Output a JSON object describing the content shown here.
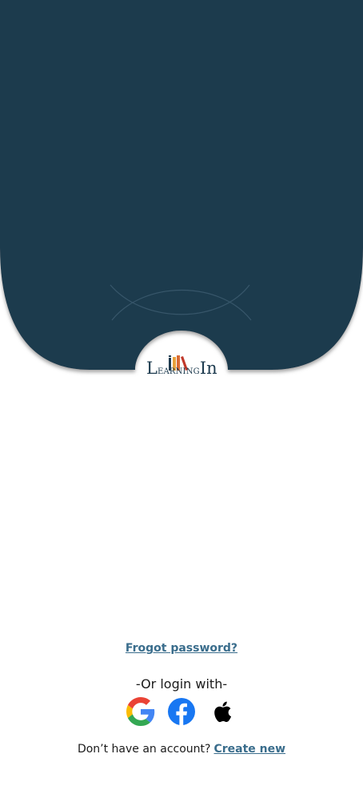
{
  "header": {
    "brand": {
      "part1_big": "L",
      "part1_small": "EARNING",
      "part2_big": "In"
    },
    "colors": {
      "background": "#1d3a4e",
      "shadow": "#b9b9b9"
    }
  },
  "links": {
    "forgot_password": "Frogot password?"
  },
  "social_login": {
    "heading": "-Or login with-",
    "providers": [
      {
        "name": "google",
        "icon": "google-icon"
      },
      {
        "name": "facebook",
        "icon": "facebook-icon"
      },
      {
        "name": "apple",
        "icon": "apple-icon"
      }
    ]
  },
  "signup": {
    "prompt": "Don’t have an account?",
    "link": "Create new"
  },
  "colors": {
    "link": "#3a6d8c",
    "text": "#1b1b1b"
  }
}
